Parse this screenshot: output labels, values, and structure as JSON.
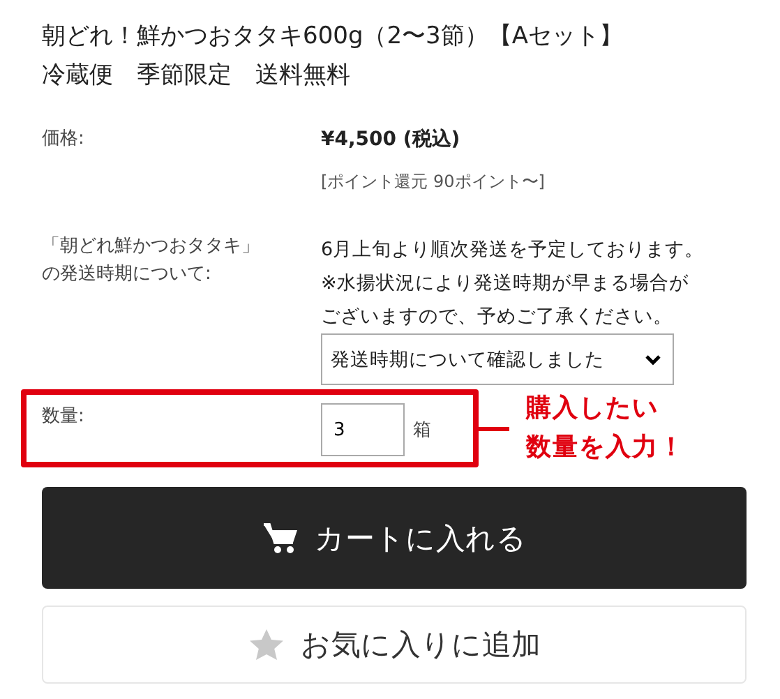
{
  "title": [
    "朝どれ！鮮かつおタタキ600g（2〜3節）【Aセット】",
    "冷蔵便　季節限定　送料無料"
  ],
  "price": {
    "label": "価格:",
    "value": "¥4,500 (税込)",
    "points": "[ポイント還元 90ポイント〜]"
  },
  "shipping": {
    "label": [
      "「朝どれ鮮かつおタタキ」",
      "の発送時期について:"
    ],
    "note": [
      "6月上旬より順次発送を予定しております。",
      "※水揚状況により発送時期が早まる場合が",
      "ございますので、予めご了承ください。"
    ],
    "select": {
      "value": "発送時期について確認しました"
    }
  },
  "quantity": {
    "label": "数量:",
    "value": "3",
    "unit": "箱"
  },
  "callout": [
    "購入したい",
    "数量を入力！"
  ],
  "buttons": [
    {
      "label": "カートに入れる",
      "kind": "cart"
    },
    {
      "label": "お気に入りに追加",
      "kind": "favorite"
    }
  ]
}
